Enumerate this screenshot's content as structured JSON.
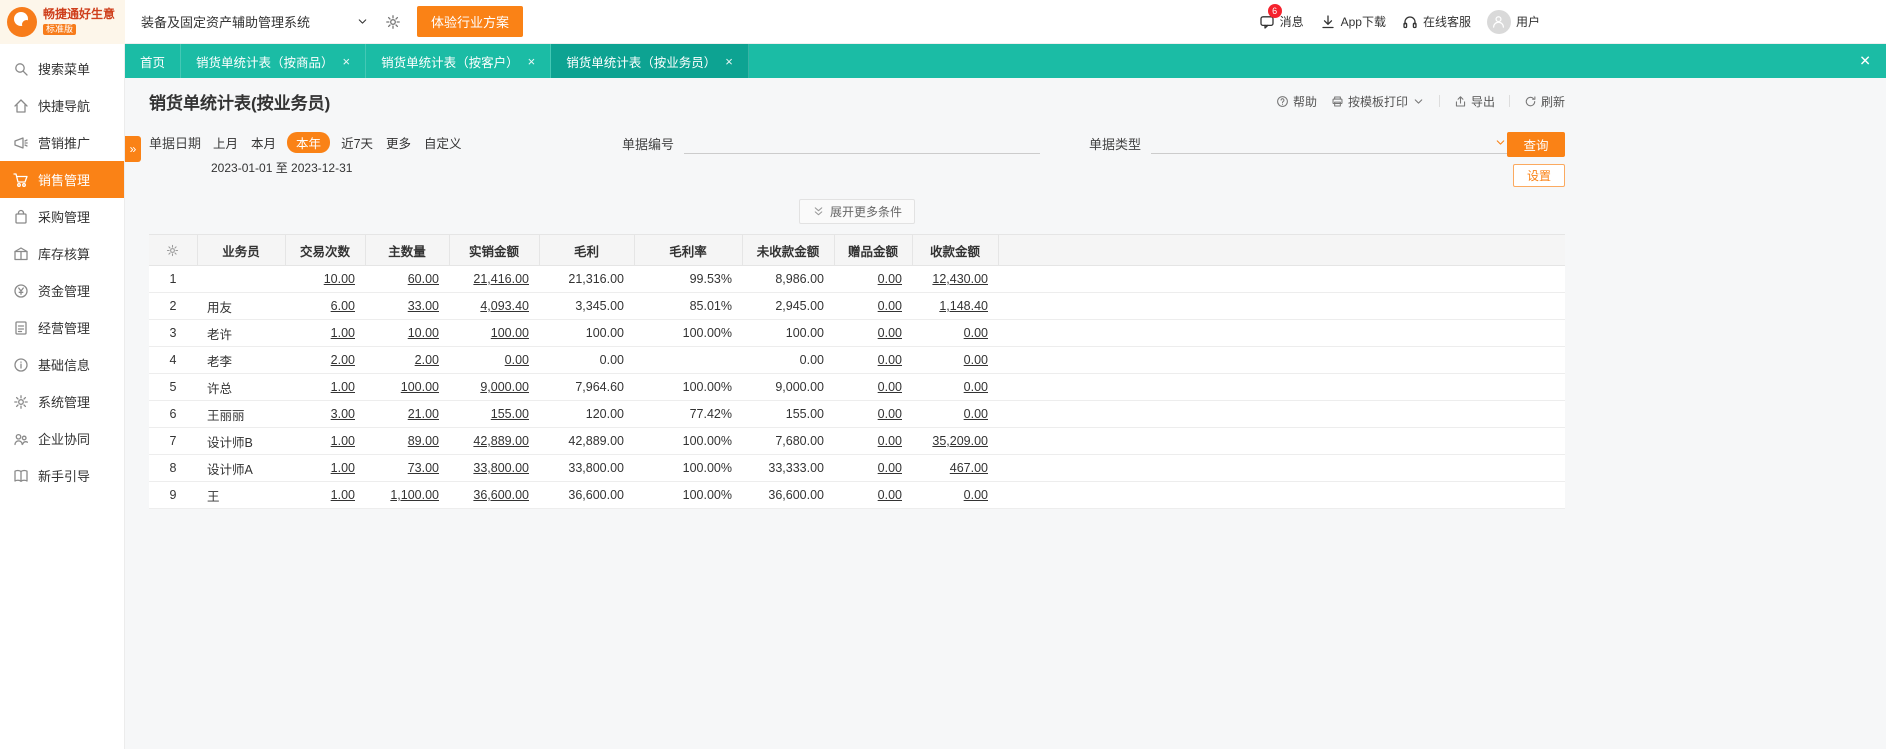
{
  "colors": {
    "accent_orange": "#fa8216",
    "teal_bar": "#1bbca5",
    "active_tab": "#0da392",
    "badge_red": "#f5222d"
  },
  "topbar": {
    "logo_text": "畅捷通好生意",
    "logo_badge": "标准版",
    "system_select": "装备及固定资产辅助管理系统",
    "trial_button": "体验行业方案",
    "messages": {
      "label": "消息",
      "badge": "6"
    },
    "app_download": "App下载",
    "online_service": "在线客服",
    "user": "用户"
  },
  "tabs": [
    {
      "name": "tab-home",
      "label": "首页",
      "closable": false,
      "active": false
    },
    {
      "name": "tab-report-by-product",
      "label": "销货单统计表（按商品）",
      "closable": true,
      "active": false
    },
    {
      "name": "tab-report-by-customer",
      "label": "销货单统计表（按客户）",
      "closable": true,
      "active": false
    },
    {
      "name": "tab-report-by-salesman",
      "label": "销货单统计表（按业务员）",
      "closable": true,
      "active": true
    }
  ],
  "sidebar": [
    {
      "name": "sidebar-item-search-menu",
      "icon": "search-icon",
      "label": "搜索菜单",
      "active": false
    },
    {
      "name": "sidebar-item-quick-nav",
      "icon": "home-icon",
      "label": "快捷导航",
      "active": false
    },
    {
      "name": "sidebar-item-marketing",
      "icon": "megaphone-icon",
      "label": "营销推广",
      "active": false
    },
    {
      "name": "sidebar-item-sales",
      "icon": "cart-icon",
      "label": "销售管理",
      "active": true
    },
    {
      "name": "sidebar-item-purchase",
      "icon": "bag-icon",
      "label": "采购管理",
      "active": false
    },
    {
      "name": "sidebar-item-inventory",
      "icon": "warehouse-icon",
      "label": "库存核算",
      "active": false
    },
    {
      "name": "sidebar-item-funds",
      "icon": "money-icon",
      "label": "资金管理",
      "active": false
    },
    {
      "name": "sidebar-item-operations",
      "icon": "report-icon",
      "label": "经营管理",
      "active": false
    },
    {
      "name": "sidebar-item-base-info",
      "icon": "info-icon",
      "label": "基础信息",
      "active": false
    },
    {
      "name": "sidebar-item-system",
      "icon": "gear-icon",
      "label": "系统管理",
      "active": false
    },
    {
      "name": "sidebar-item-enterprise-collab",
      "icon": "collab-icon",
      "label": "企业协同",
      "active": false
    },
    {
      "name": "sidebar-item-beginner-guide",
      "icon": "book-icon",
      "label": "新手引导",
      "active": false
    }
  ],
  "page": {
    "title": "销货单统计表(按业务员)",
    "toolbar": {
      "help": "帮助",
      "print": "按模板打印",
      "export": "导出",
      "refresh": "刷新"
    }
  },
  "filters": {
    "date_label": "单据日期",
    "date_options": [
      "上月",
      "本月",
      "本年",
      "近7天",
      "更多",
      "自定义"
    ],
    "date_selected": "本年",
    "date_range": "2023-01-01 至 2023-12-31",
    "doc_no_label": "单据编号",
    "doc_type_label": "单据类型",
    "search_button": "查询",
    "settings_button": "设置",
    "expand_more": "展开更多条件"
  },
  "table": {
    "columns": [
      {
        "key": "name",
        "label": "业务员",
        "align": "left",
        "link": false
      },
      {
        "key": "trades",
        "label": "交易次数",
        "align": "right",
        "link": true
      },
      {
        "key": "qty",
        "label": "主数量",
        "align": "right",
        "link": true
      },
      {
        "key": "sales",
        "label": "实销金额",
        "align": "right",
        "link": true
      },
      {
        "key": "profit",
        "label": "毛利",
        "align": "right",
        "link": false
      },
      {
        "key": "margin",
        "label": "毛利率",
        "align": "right",
        "link": false
      },
      {
        "key": "unpaid",
        "label": "未收款金额",
        "align": "right",
        "link": false
      },
      {
        "key": "gift",
        "label": "赠品金额",
        "align": "right",
        "link": true
      },
      {
        "key": "received",
        "label": "收款金额",
        "align": "right",
        "link": true
      }
    ],
    "rows": [
      {
        "no": "1",
        "name": "",
        "trades": "10.00",
        "qty": "60.00",
        "sales": "21,416.00",
        "profit": "21,316.00",
        "margin": "99.53%",
        "unpaid": "8,986.00",
        "gift": "0.00",
        "received": "12,430.00"
      },
      {
        "no": "2",
        "name": "用友",
        "trades": "6.00",
        "qty": "33.00",
        "sales": "4,093.40",
        "profit": "3,345.00",
        "margin": "85.01%",
        "unpaid": "2,945.00",
        "gift": "0.00",
        "received": "1,148.40"
      },
      {
        "no": "3",
        "name": "老许",
        "trades": "1.00",
        "qty": "10.00",
        "sales": "100.00",
        "profit": "100.00",
        "margin": "100.00%",
        "unpaid": "100.00",
        "gift": "0.00",
        "received": "0.00"
      },
      {
        "no": "4",
        "name": "老李",
        "trades": "2.00",
        "qty": "2.00",
        "sales": "0.00",
        "profit": "0.00",
        "margin": "",
        "unpaid": "0.00",
        "gift": "0.00",
        "received": "0.00"
      },
      {
        "no": "5",
        "name": "许总",
        "trades": "1.00",
        "qty": "100.00",
        "sales": "9,000.00",
        "profit": "7,964.60",
        "margin": "100.00%",
        "unpaid": "9,000.00",
        "gift": "0.00",
        "received": "0.00"
      },
      {
        "no": "6",
        "name": "王丽丽",
        "trades": "3.00",
        "qty": "21.00",
        "sales": "155.00",
        "profit": "120.00",
        "margin": "77.42%",
        "unpaid": "155.00",
        "gift": "0.00",
        "received": "0.00"
      },
      {
        "no": "7",
        "name": "设计师B",
        "trades": "1.00",
        "qty": "89.00",
        "sales": "42,889.00",
        "profit": "42,889.00",
        "margin": "100.00%",
        "unpaid": "7,680.00",
        "gift": "0.00",
        "received": "35,209.00"
      },
      {
        "no": "8",
        "name": "设计师A",
        "trades": "1.00",
        "qty": "73.00",
        "sales": "33,800.00",
        "profit": "33,800.00",
        "margin": "100.00%",
        "unpaid": "33,333.00",
        "gift": "0.00",
        "received": "467.00"
      },
      {
        "no": "9",
        "name": "王",
        "trades": "1.00",
        "qty": "1,100.00",
        "sales": "36,600.00",
        "profit": "36,600.00",
        "margin": "100.00%",
        "unpaid": "36,600.00",
        "gift": "0.00",
        "received": "0.00"
      }
    ]
  }
}
